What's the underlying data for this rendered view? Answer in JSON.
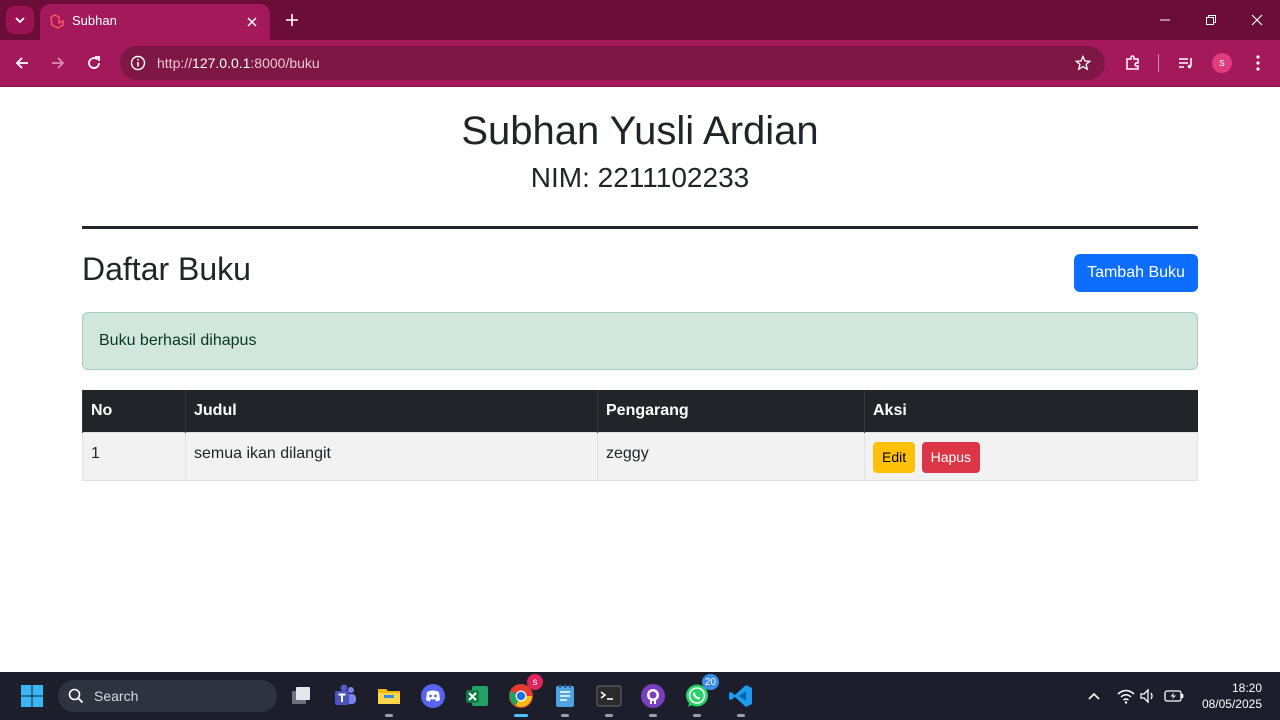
{
  "browser": {
    "tab_title": "Subhan",
    "url_prefix": "http://",
    "url_host": "127.0.0.1",
    "url_rest": ":8000/buku",
    "profile_initial": "s"
  },
  "page": {
    "name": "Subhan Yusli Ardian",
    "nim": "NIM: 2211102233",
    "title": "Daftar Buku",
    "add_button": "Tambah Buku",
    "alert": "Buku berhasil dihapus",
    "table": {
      "headers": [
        "No",
        "Judul",
        "Pengarang",
        "Aksi"
      ],
      "rows": [
        {
          "no": "1",
          "judul": "semua ikan dilangit",
          "pengarang": "zeggy",
          "edit": "Edit",
          "hapus": "Hapus"
        }
      ]
    }
  },
  "taskbar": {
    "search_label": "Search",
    "chrome_badge": "s",
    "whatsapp_badge": "20",
    "time": "18:20",
    "date": "08/05/2025"
  },
  "colors": {
    "tabbar": "#6b0d37",
    "toolbar": "#a3195b",
    "primary": "#0d6efd",
    "alert_bg": "#d1e7dd",
    "table_head": "#212529",
    "edit": "#ffc107",
    "delete": "#dc3545"
  }
}
